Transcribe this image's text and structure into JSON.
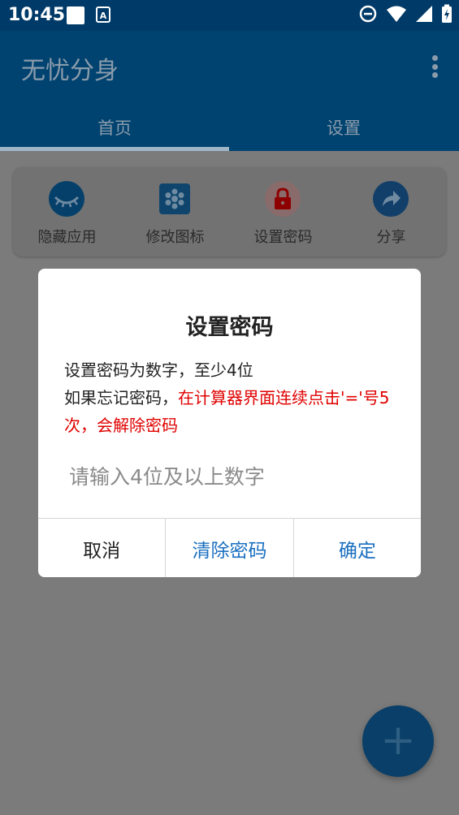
{
  "status_bar": {
    "time": "10:45",
    "notif_a_label": "A"
  },
  "app": {
    "title": "无忧分身"
  },
  "tabs": [
    {
      "label": "首页"
    },
    {
      "label": "设置"
    }
  ],
  "features": [
    {
      "label": "隐藏应用",
      "icon": "eye-closed-icon",
      "color": "#05406a"
    },
    {
      "label": "修改图标",
      "icon": "grid-hex-icon",
      "color": "#0f456c"
    },
    {
      "label": "设置密码",
      "icon": "lock-icon",
      "color": "#8e0000"
    },
    {
      "label": "分享",
      "icon": "share-icon",
      "color": "#123f6a"
    }
  ],
  "fab": {
    "icon": "plus-icon",
    "symbol": "+"
  },
  "dialog": {
    "title": "设置密码",
    "line1": "设置密码为数字，至少4位",
    "line2_prefix": "如果忘记密码，",
    "line2_warning": "在计算器界面连续点击'='号5次，会解除密码",
    "input_placeholder": "请输入4位及以上数字",
    "input_value": "",
    "buttons": {
      "cancel": "取消",
      "clear": "清除密码",
      "confirm": "确定"
    }
  },
  "colors": {
    "appbar": "#004370",
    "overlay_bg": "#7b7b7b",
    "warning": "#e00000",
    "accent_button": "#1a6fc0"
  }
}
